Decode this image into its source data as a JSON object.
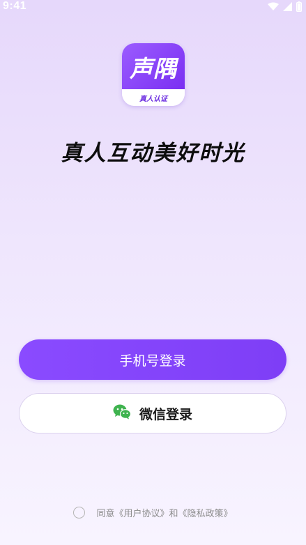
{
  "status_bar": {
    "time": "9:41",
    "icons": [
      "wifi-icon",
      "signal-icon",
      "battery-icon"
    ]
  },
  "logo": {
    "main_text": "声隅",
    "sub_text": "真人认证",
    "colors": {
      "gradient_start": "#9b5cff",
      "gradient_end": "#7a2ff2"
    }
  },
  "slogan": "真人互动美好时光",
  "buttons": {
    "phone_login": "手机号登录",
    "wechat_login": "微信登录"
  },
  "agreement": {
    "prefix": "同意",
    "user_agreement": "《用户协议》",
    "conjunction": "和",
    "privacy_policy": "《隐私政策》"
  },
  "colors": {
    "accent": "#8a4bff",
    "wechat_green": "#3fb34f"
  }
}
